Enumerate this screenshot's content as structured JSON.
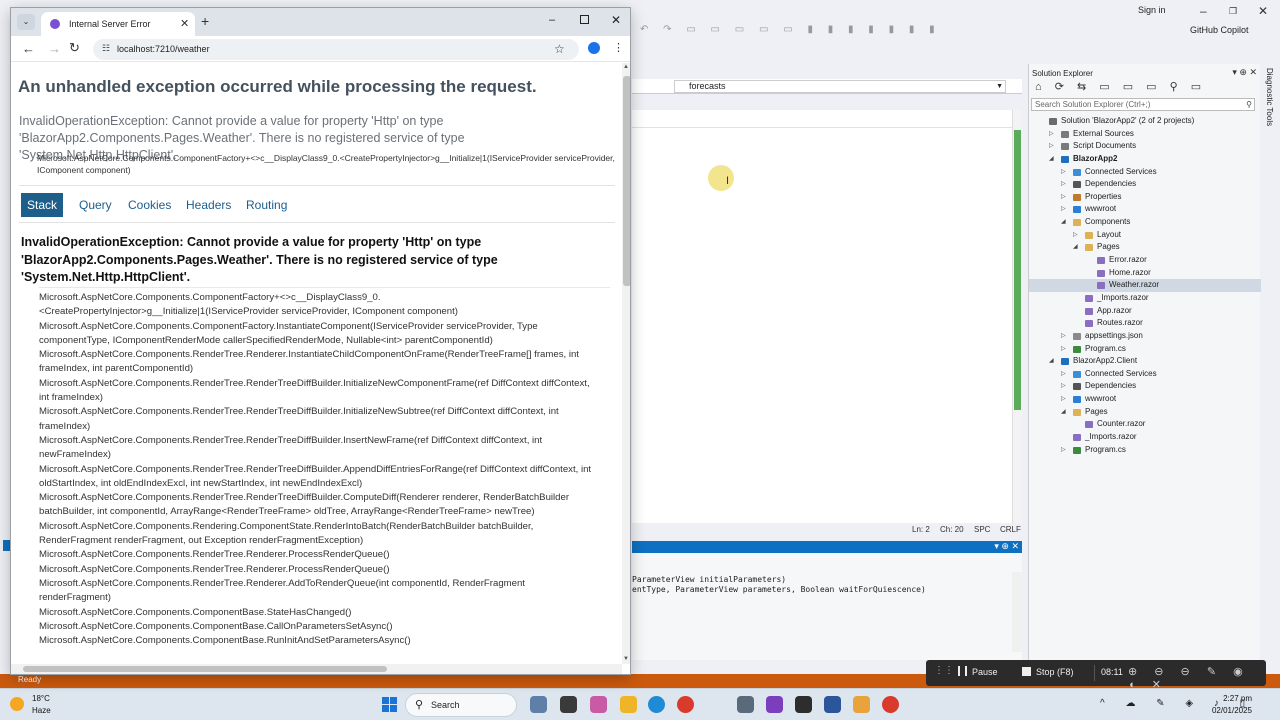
{
  "browser": {
    "tab_title": "Internal Server Error",
    "url": "localhost:7210/weather"
  },
  "error_page": {
    "heading": "An unhandled exception occurred while processing the request.",
    "message_line1": "InvalidOperationException: Cannot provide a value for property 'Http' on type",
    "message_line2": "'BlazorApp2.Components.Pages.Weather'. There is no registered service of type 'System.Net.Http.HttpClient'.",
    "location_line1": "Microsoft.AspNetCore.Components.ComponentFactory+<>c__DisplayClass9_0.<CreatePropertyInjector>g__Initialize|1(IServiceProvider serviceProvider,",
    "location_line2": "IComponent component)",
    "tabs": [
      {
        "label": "Stack",
        "active": true
      },
      {
        "label": "Query",
        "active": false
      },
      {
        "label": "Cookies",
        "active": false
      },
      {
        "label": "Headers",
        "active": false
      },
      {
        "label": "Routing",
        "active": false
      }
    ],
    "stack_title_line1": "InvalidOperationException: Cannot provide a value for property 'Http' on type",
    "stack_title_line2": "'BlazorApp2.Components.Pages.Weather'. There is no registered service of type",
    "stack_title_line3": "'System.Net.Http.HttpClient'.",
    "frames": [
      {
        "line1": "Microsoft.AspNetCore.Components.ComponentFactory+<>c__DisplayClass9_0.",
        "line2": "<CreatePropertyInjector>g__Initialize|1(IServiceProvider serviceProvider, IComponent component)"
      },
      {
        "line1": "Microsoft.AspNetCore.Components.ComponentFactory.InstantiateComponent(IServiceProvider serviceProvider, Type",
        "line2": "componentType, IComponentRenderMode callerSpecifiedRenderMode, Nullable<int> parentComponentId)"
      },
      {
        "line1": "Microsoft.AspNetCore.Components.RenderTree.Renderer.InstantiateChildComponentOnFrame(RenderTreeFrame[] frames, int",
        "line2": "frameIndex, int parentComponentId)"
      },
      {
        "line1": "Microsoft.AspNetCore.Components.RenderTree.RenderTreeDiffBuilder.InitializeNewComponentFrame(ref DiffContext diffContext,",
        "line2": "int frameIndex)"
      },
      {
        "line1": "Microsoft.AspNetCore.Components.RenderTree.RenderTreeDiffBuilder.InitializeNewSubtree(ref DiffContext diffContext, int",
        "line2": "frameIndex)"
      },
      {
        "line1": "Microsoft.AspNetCore.Components.RenderTree.RenderTreeDiffBuilder.InsertNewFrame(ref DiffContext diffContext, int",
        "line2": "newFrameIndex)"
      },
      {
        "line1": "Microsoft.AspNetCore.Components.RenderTree.RenderTreeDiffBuilder.AppendDiffEntriesForRange(ref DiffContext diffContext, int",
        "line2": "oldStartIndex, int oldEndIndexExcl, int newStartIndex, int newEndIndexExcl)"
      },
      {
        "line1": "Microsoft.AspNetCore.Components.RenderTree.RenderTreeDiffBuilder.ComputeDiff(Renderer renderer, RenderBatchBuilder",
        "line2": "batchBuilder, int componentId, ArrayRange<RenderTreeFrame> oldTree, ArrayRange<RenderTreeFrame> newTree)"
      },
      {
        "line1": "Microsoft.AspNetCore.Components.Rendering.ComponentState.RenderIntoBatch(RenderBatchBuilder batchBuilder,",
        "line2": "RenderFragment renderFragment, out Exception renderFragmentException)"
      },
      {
        "line1": "Microsoft.AspNetCore.Components.RenderTree.Renderer.ProcessRenderQueue()",
        "line2": ""
      },
      {
        "line1": "Microsoft.AspNetCore.Components.RenderTree.Renderer.ProcessRenderQueue()",
        "line2": ""
      },
      {
        "line1": "Microsoft.AspNetCore.Components.RenderTree.Renderer.AddToRenderQueue(int componentId, RenderFragment",
        "line2": "renderFragment)"
      },
      {
        "line1": "Microsoft.AspNetCore.Components.ComponentBase.StateHasChanged()",
        "line2": ""
      },
      {
        "line1": "Microsoft.AspNetCore.Components.ComponentBase.CallOnParametersSetAsync()",
        "line2": ""
      },
      {
        "line1": "Microsoft.AspNetCore.Components.ComponentBase.RunInitAndSetParametersAsync()",
        "line2": ""
      }
    ]
  },
  "vs": {
    "sign_in": "Sign in",
    "copilot": "GitHub Copilot",
    "editor_dropdown": "forecasts",
    "status_ln": "Ln: 2",
    "status_ch": "Ch: 20",
    "status_spc": "SPC",
    "status_crlf": "CRLF",
    "output_line1": "ParameterView initialParameters)",
    "output_line2": "entType, ParameterView parameters, Boolean waitForQuiescence)",
    "ready": "Ready",
    "diagnostic_tools": "Diagnostic Tools",
    "solution_explorer": {
      "title": "Solution Explorer",
      "search_placeholder": "Search Solution Explorer (Ctrl+;)",
      "items": [
        {
          "label": "Solution 'BlazorApp2' (2 of 2 projects)",
          "icon": "solution-icon",
          "color": "#6b6b6b"
        },
        {
          "label": "External Sources",
          "icon": "external-sources-icon",
          "color": "#7a7a7a"
        },
        {
          "label": "Script Documents",
          "icon": "script-documents-icon",
          "color": "#7a7a7a"
        },
        {
          "label": "BlazorApp2",
          "icon": "web-project-icon",
          "color": "#1f6fbf"
        },
        {
          "label": "Connected Services",
          "icon": "connected-services-icon",
          "color": "#3a8fd8"
        },
        {
          "label": "Dependencies",
          "icon": "dependencies-icon",
          "color": "#555555"
        },
        {
          "label": "Properties",
          "icon": "properties-icon",
          "color": "#c07a2d"
        },
        {
          "label": "wwwroot",
          "icon": "globe-icon",
          "color": "#2a7fd4"
        },
        {
          "label": "Components",
          "icon": "folder-icon",
          "color": "#dcb255"
        },
        {
          "label": "Layout",
          "icon": "folder-icon",
          "color": "#dcb255"
        },
        {
          "label": "Pages",
          "icon": "folder-icon",
          "color": "#dcb255"
        },
        {
          "label": "Error.razor",
          "icon": "razor-file-icon",
          "color": "#8a6fc0"
        },
        {
          "label": "Home.razor",
          "icon": "razor-file-icon",
          "color": "#8a6fc0"
        },
        {
          "label": "Weather.razor",
          "icon": "razor-file-icon",
          "color": "#8a6fc0"
        },
        {
          "label": "_Imports.razor",
          "icon": "razor-file-icon",
          "color": "#8a6fc0"
        },
        {
          "label": "App.razor",
          "icon": "razor-file-icon",
          "color": "#8a6fc0"
        },
        {
          "label": "Routes.razor",
          "icon": "razor-file-icon",
          "color": "#8a6fc0"
        },
        {
          "label": "appsettings.json",
          "icon": "json-file-icon",
          "color": "#8a8a8a"
        },
        {
          "label": "Program.cs",
          "icon": "csharp-file-icon",
          "color": "#3c8a3c"
        },
        {
          "label": "BlazorApp2.Client",
          "icon": "project-icon",
          "color": "#1f6fbf"
        },
        {
          "label": "Connected Services",
          "icon": "connected-services-icon",
          "color": "#3a8fd8"
        },
        {
          "label": "Dependencies",
          "icon": "dependencies-icon",
          "color": "#555555"
        },
        {
          "label": "wwwroot",
          "icon": "globe-icon",
          "color": "#2a7fd4"
        },
        {
          "label": "Pages",
          "icon": "folder-icon",
          "color": "#dcb255"
        },
        {
          "label": "Counter.razor",
          "icon": "razor-file-icon",
          "color": "#8a6fc0"
        },
        {
          "label": "_Imports.razor",
          "icon": "razor-file-icon",
          "color": "#8a6fc0"
        },
        {
          "label": "Program.cs",
          "icon": "csharp-file-icon",
          "color": "#3c8a3c"
        }
      ],
      "selected": "Weather.razor"
    }
  },
  "recorder": {
    "pause_label": "Pause",
    "stop_label": "Stop (F8)",
    "elapsed": "08:11"
  },
  "taskbar": {
    "temperature": "18°C",
    "condition": "Haze",
    "search_label": "Search",
    "time": "2:27 pm",
    "date": "02/01/2025"
  }
}
